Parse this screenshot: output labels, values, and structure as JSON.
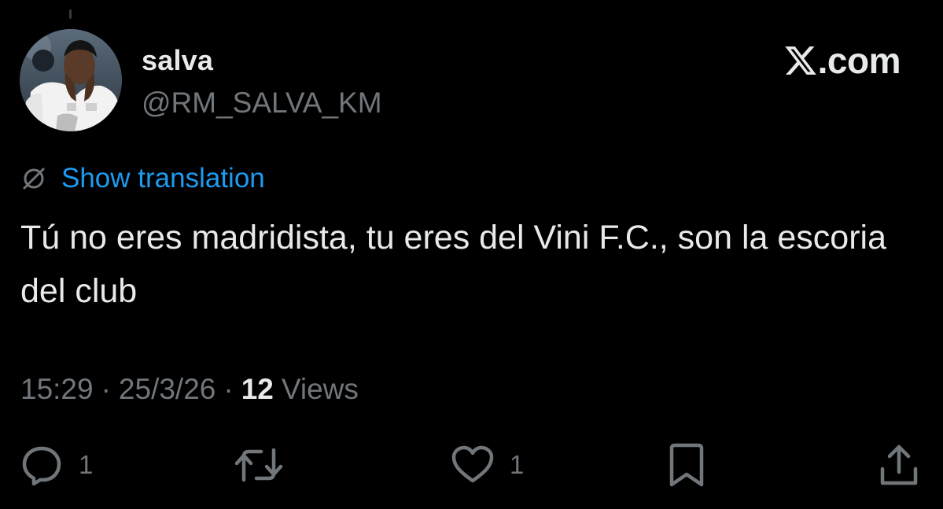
{
  "author": {
    "display_name": "salva",
    "handle": "@RM_SALVA_KM",
    "avatar_icon": "profile-photo"
  },
  "brand": {
    "label": ".com",
    "icon": "x-logo-icon"
  },
  "translation": {
    "label": "Show translation",
    "icon": "globe-icon"
  },
  "tweet": {
    "text": "Tú no eres madridista, tu eres del Vini F.C., son la escoria del club"
  },
  "meta": {
    "time": "15:29",
    "date": "25/3/26",
    "separator": "·",
    "views_count": "12",
    "views_label": "Views"
  },
  "actions": {
    "reply": {
      "icon": "reply-icon",
      "count": "1"
    },
    "repost": {
      "icon": "repost-icon"
    },
    "like": {
      "icon": "heart-icon",
      "count": "1"
    },
    "bookmark": {
      "icon": "bookmark-icon"
    },
    "share": {
      "icon": "share-icon"
    }
  },
  "colors": {
    "background": "#000000",
    "primary_text": "#e7e9ea",
    "secondary_text": "#71767b",
    "link": "#1d9bf0"
  }
}
